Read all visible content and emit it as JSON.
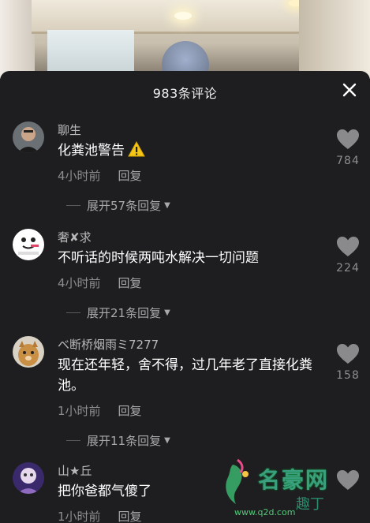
{
  "panel": {
    "title": "983条评论"
  },
  "comments": [
    {
      "username": "聊生",
      "text": "化粪池警告",
      "has_warning_icon": true,
      "time": "4小时前",
      "reply_label": "回复",
      "likes": "784",
      "expand_label": "展开57条回复"
    },
    {
      "username": "奢✘求",
      "text": "不听话的时候两吨水解决一切问题",
      "has_warning_icon": false,
      "time": "4小时前",
      "reply_label": "回复",
      "likes": "224",
      "expand_label": "展开21条回复"
    },
    {
      "username": "ベ断桥烟雨ミ7277",
      "text": "现在还年轻，舍不得，过几年老了直接化粪池。",
      "has_warning_icon": false,
      "time": "1小时前",
      "reply_label": "回复",
      "likes": "158",
      "expand_label": "展开11条回复"
    },
    {
      "username": "山★丘",
      "text": "把你爸都气傻了",
      "has_warning_icon": false,
      "time": "1小时前",
      "reply_label": "回复"
    }
  ],
  "watermark": {
    "brand": "名豪网",
    "sub": "趣丁",
    "url": "www.q2d.com"
  },
  "colors": {
    "panel_bg": "#1e1e20",
    "text_primary": "#ffffff",
    "text_secondary": "#8d8d90",
    "heart": "#8a8a8d",
    "watermark": "#3fae8a"
  },
  "icons": {
    "close": "close-icon",
    "like": "heart-icon",
    "warning": "warning-icon",
    "expand": "triangle-down-icon"
  }
}
